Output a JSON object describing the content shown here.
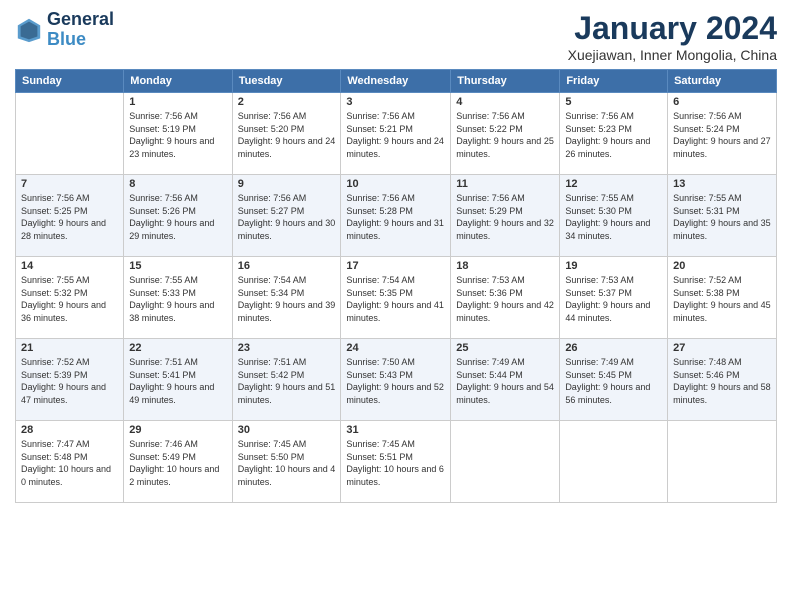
{
  "logo": {
    "line1": "General",
    "line2": "Blue"
  },
  "title": "January 2024",
  "subtitle": "Xuejiawan, Inner Mongolia, China",
  "headers": [
    "Sunday",
    "Monday",
    "Tuesday",
    "Wednesday",
    "Thursday",
    "Friday",
    "Saturday"
  ],
  "weeks": [
    [
      {
        "day": "",
        "sunrise": "",
        "sunset": "",
        "daylight": ""
      },
      {
        "day": "1",
        "sunrise": "Sunrise: 7:56 AM",
        "sunset": "Sunset: 5:19 PM",
        "daylight": "Daylight: 9 hours and 23 minutes."
      },
      {
        "day": "2",
        "sunrise": "Sunrise: 7:56 AM",
        "sunset": "Sunset: 5:20 PM",
        "daylight": "Daylight: 9 hours and 24 minutes."
      },
      {
        "day": "3",
        "sunrise": "Sunrise: 7:56 AM",
        "sunset": "Sunset: 5:21 PM",
        "daylight": "Daylight: 9 hours and 24 minutes."
      },
      {
        "day": "4",
        "sunrise": "Sunrise: 7:56 AM",
        "sunset": "Sunset: 5:22 PM",
        "daylight": "Daylight: 9 hours and 25 minutes."
      },
      {
        "day": "5",
        "sunrise": "Sunrise: 7:56 AM",
        "sunset": "Sunset: 5:23 PM",
        "daylight": "Daylight: 9 hours and 26 minutes."
      },
      {
        "day": "6",
        "sunrise": "Sunrise: 7:56 AM",
        "sunset": "Sunset: 5:24 PM",
        "daylight": "Daylight: 9 hours and 27 minutes."
      }
    ],
    [
      {
        "day": "7",
        "sunrise": "Sunrise: 7:56 AM",
        "sunset": "Sunset: 5:25 PM",
        "daylight": "Daylight: 9 hours and 28 minutes."
      },
      {
        "day": "8",
        "sunrise": "Sunrise: 7:56 AM",
        "sunset": "Sunset: 5:26 PM",
        "daylight": "Daylight: 9 hours and 29 minutes."
      },
      {
        "day": "9",
        "sunrise": "Sunrise: 7:56 AM",
        "sunset": "Sunset: 5:27 PM",
        "daylight": "Daylight: 9 hours and 30 minutes."
      },
      {
        "day": "10",
        "sunrise": "Sunrise: 7:56 AM",
        "sunset": "Sunset: 5:28 PM",
        "daylight": "Daylight: 9 hours and 31 minutes."
      },
      {
        "day": "11",
        "sunrise": "Sunrise: 7:56 AM",
        "sunset": "Sunset: 5:29 PM",
        "daylight": "Daylight: 9 hours and 32 minutes."
      },
      {
        "day": "12",
        "sunrise": "Sunrise: 7:55 AM",
        "sunset": "Sunset: 5:30 PM",
        "daylight": "Daylight: 9 hours and 34 minutes."
      },
      {
        "day": "13",
        "sunrise": "Sunrise: 7:55 AM",
        "sunset": "Sunset: 5:31 PM",
        "daylight": "Daylight: 9 hours and 35 minutes."
      }
    ],
    [
      {
        "day": "14",
        "sunrise": "Sunrise: 7:55 AM",
        "sunset": "Sunset: 5:32 PM",
        "daylight": "Daylight: 9 hours and 36 minutes."
      },
      {
        "day": "15",
        "sunrise": "Sunrise: 7:55 AM",
        "sunset": "Sunset: 5:33 PM",
        "daylight": "Daylight: 9 hours and 38 minutes."
      },
      {
        "day": "16",
        "sunrise": "Sunrise: 7:54 AM",
        "sunset": "Sunset: 5:34 PM",
        "daylight": "Daylight: 9 hours and 39 minutes."
      },
      {
        "day": "17",
        "sunrise": "Sunrise: 7:54 AM",
        "sunset": "Sunset: 5:35 PM",
        "daylight": "Daylight: 9 hours and 41 minutes."
      },
      {
        "day": "18",
        "sunrise": "Sunrise: 7:53 AM",
        "sunset": "Sunset: 5:36 PM",
        "daylight": "Daylight: 9 hours and 42 minutes."
      },
      {
        "day": "19",
        "sunrise": "Sunrise: 7:53 AM",
        "sunset": "Sunset: 5:37 PM",
        "daylight": "Daylight: 9 hours and 44 minutes."
      },
      {
        "day": "20",
        "sunrise": "Sunrise: 7:52 AM",
        "sunset": "Sunset: 5:38 PM",
        "daylight": "Daylight: 9 hours and 45 minutes."
      }
    ],
    [
      {
        "day": "21",
        "sunrise": "Sunrise: 7:52 AM",
        "sunset": "Sunset: 5:39 PM",
        "daylight": "Daylight: 9 hours and 47 minutes."
      },
      {
        "day": "22",
        "sunrise": "Sunrise: 7:51 AM",
        "sunset": "Sunset: 5:41 PM",
        "daylight": "Daylight: 9 hours and 49 minutes."
      },
      {
        "day": "23",
        "sunrise": "Sunrise: 7:51 AM",
        "sunset": "Sunset: 5:42 PM",
        "daylight": "Daylight: 9 hours and 51 minutes."
      },
      {
        "day": "24",
        "sunrise": "Sunrise: 7:50 AM",
        "sunset": "Sunset: 5:43 PM",
        "daylight": "Daylight: 9 hours and 52 minutes."
      },
      {
        "day": "25",
        "sunrise": "Sunrise: 7:49 AM",
        "sunset": "Sunset: 5:44 PM",
        "daylight": "Daylight: 9 hours and 54 minutes."
      },
      {
        "day": "26",
        "sunrise": "Sunrise: 7:49 AM",
        "sunset": "Sunset: 5:45 PM",
        "daylight": "Daylight: 9 hours and 56 minutes."
      },
      {
        "day": "27",
        "sunrise": "Sunrise: 7:48 AM",
        "sunset": "Sunset: 5:46 PM",
        "daylight": "Daylight: 9 hours and 58 minutes."
      }
    ],
    [
      {
        "day": "28",
        "sunrise": "Sunrise: 7:47 AM",
        "sunset": "Sunset: 5:48 PM",
        "daylight": "Daylight: 10 hours and 0 minutes."
      },
      {
        "day": "29",
        "sunrise": "Sunrise: 7:46 AM",
        "sunset": "Sunset: 5:49 PM",
        "daylight": "Daylight: 10 hours and 2 minutes."
      },
      {
        "day": "30",
        "sunrise": "Sunrise: 7:45 AM",
        "sunset": "Sunset: 5:50 PM",
        "daylight": "Daylight: 10 hours and 4 minutes."
      },
      {
        "day": "31",
        "sunrise": "Sunrise: 7:45 AM",
        "sunset": "Sunset: 5:51 PM",
        "daylight": "Daylight: 10 hours and 6 minutes."
      },
      {
        "day": "",
        "sunrise": "",
        "sunset": "",
        "daylight": ""
      },
      {
        "day": "",
        "sunrise": "",
        "sunset": "",
        "daylight": ""
      },
      {
        "day": "",
        "sunrise": "",
        "sunset": "",
        "daylight": ""
      }
    ]
  ]
}
